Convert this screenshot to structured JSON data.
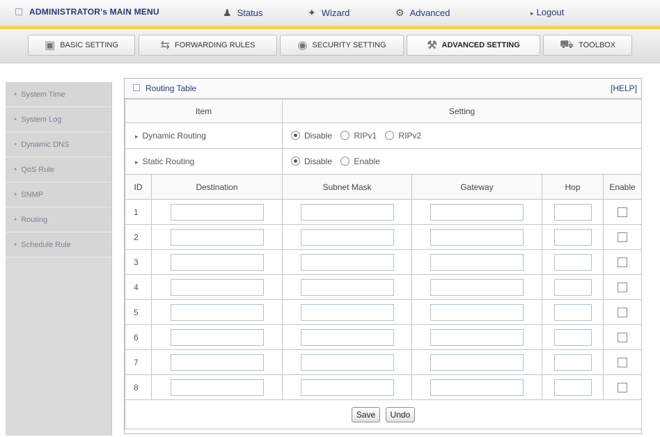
{
  "topmenu": {
    "admin": "ADMINISTRATOR's MAIN MENU",
    "status": "Status",
    "wizard": "Wizard",
    "advanced": "Advanced",
    "logout": "Logout"
  },
  "tabs": {
    "basic": "BASIC SETTING",
    "forwarding": "FORWARDING RULES",
    "security": "SECURITY SETTING",
    "advanced": "ADVANCED SETTING",
    "toolbox": "TOOLBOX"
  },
  "sidebar": {
    "items": [
      {
        "label": "System Time"
      },
      {
        "label": "System Log"
      },
      {
        "label": "Dynamic DNS"
      },
      {
        "label": "QoS Rule"
      },
      {
        "label": "SNMP"
      },
      {
        "label": "Routing"
      },
      {
        "label": "Schedule Rule"
      }
    ]
  },
  "panel": {
    "title": "Routing Table",
    "help": "[HELP]",
    "col_item": "Item",
    "col_setting": "Setting",
    "dynamic": {
      "label": "Dynamic Routing",
      "options": [
        "Disable",
        "RIPv1",
        "RIPv2"
      ],
      "selected": "Disable"
    },
    "static": {
      "label": "Static Routing",
      "options": [
        "Disable",
        "Enable"
      ],
      "selected": "Disable"
    },
    "columns": {
      "id": "ID",
      "destination": "Destination",
      "subnet": "Subnet Mask",
      "gateway": "Gateway",
      "hop": "Hop",
      "enable": "Enable"
    },
    "rows": [
      "1",
      "2",
      "3",
      "4",
      "5",
      "6",
      "7",
      "8"
    ],
    "save": "Save",
    "undo": "Undo"
  }
}
